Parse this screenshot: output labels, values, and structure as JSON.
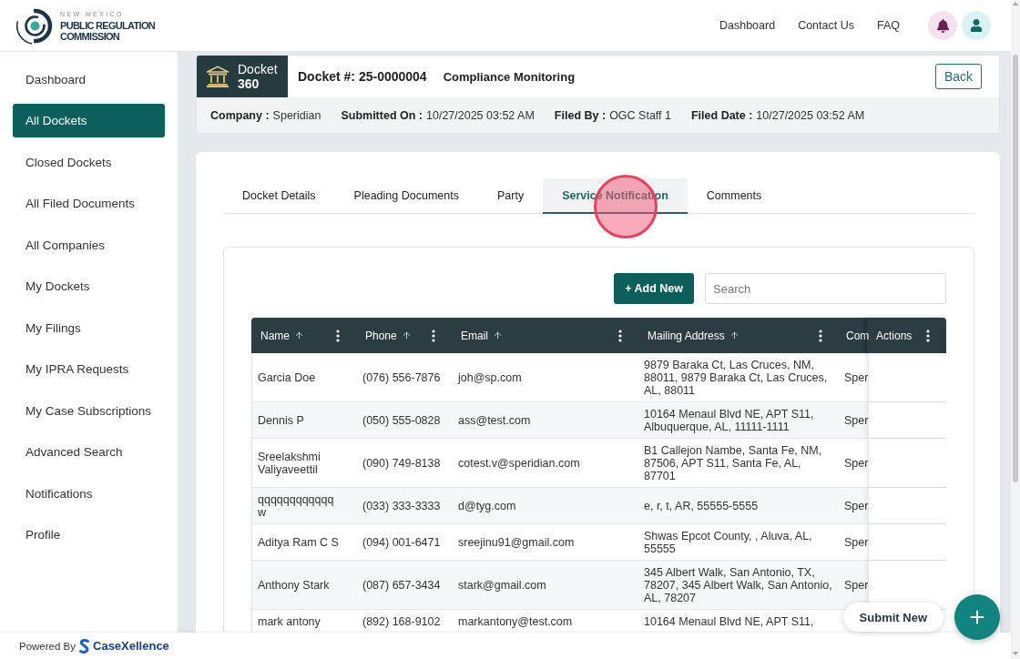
{
  "header": {
    "logo": {
      "subtitle": "NEW MEXICO",
      "title_lines": [
        "PUBLIC REGULATION",
        "COMMISSION"
      ]
    },
    "nav": [
      "Dashboard",
      "Contact Us",
      "FAQ"
    ]
  },
  "sidebar": {
    "items": [
      {
        "label": "Dashboard",
        "selected": false
      },
      {
        "label": "All Dockets",
        "selected": true
      },
      {
        "label": "Closed Dockets",
        "selected": false
      },
      {
        "label": "All Filed Documents",
        "selected": false
      },
      {
        "label": "All Companies",
        "selected": false
      },
      {
        "label": "My Dockets",
        "selected": false
      },
      {
        "label": "My Filings",
        "selected": false
      },
      {
        "label": "My IPRA Requests",
        "selected": false
      },
      {
        "label": "My Case Subscriptions",
        "selected": false
      },
      {
        "label": "Advanced Search",
        "selected": false
      },
      {
        "label": "Notifications",
        "selected": false
      },
      {
        "label": "Profile",
        "selected": false
      }
    ]
  },
  "docket": {
    "badge": {
      "title": "Docket",
      "number": "360"
    },
    "number": "Docket #: 25-0000004",
    "type": "Compliance Monitoring",
    "back_button": "Back",
    "meta": [
      {
        "label": "Company :",
        "value": "Speridian"
      },
      {
        "label": "Submitted On :",
        "value": "10/27/2025 03:52 AM"
      },
      {
        "label": "Filed By :",
        "value": "OGC Staff 1"
      },
      {
        "label": "Filed Date :",
        "value": "10/27/2025 03:52 AM"
      }
    ]
  },
  "tabs": [
    {
      "label": "Docket Details",
      "selected": false
    },
    {
      "label": "Pleading Documents",
      "selected": false
    },
    {
      "label": "Party",
      "selected": false
    },
    {
      "label": "Service Notification",
      "selected": true
    },
    {
      "label": "Comments",
      "selected": false
    }
  ],
  "service_list": {
    "add_button": "+ Add New",
    "search": {
      "placeholder": "Search"
    },
    "table": {
      "columns": [
        {
          "label": "Name",
          "sortable": true,
          "menu": true
        },
        {
          "label": "Phone",
          "sortable": true,
          "menu": true
        },
        {
          "label": "Email",
          "sortable": true,
          "menu": true
        },
        {
          "label": "Mailing Address",
          "sortable": true,
          "menu": true
        },
        {
          "label": "Com",
          "sortable": false,
          "menu": false
        },
        {
          "label": "Actions",
          "sortable": false,
          "menu": true
        }
      ],
      "rows": [
        {
          "name": "Garcia Doe",
          "phone": "(076) 556-7876",
          "email": "joh@sp.com",
          "mailing_address": "9879 Baraka Ct, Las Cruces, NM, 88011, 9879 Baraka Ct, Las Cruces, AL, 88011",
          "company": "Sper"
        },
        {
          "name": "Dennis P",
          "phone": "(050) 555-0828",
          "email": "ass@test.com",
          "mailing_address": "10164 Menaul Blvd NE, APT S11, Albuquerque, AL, 11111-1111",
          "company": "Sper"
        },
        {
          "name": "Sreelakshmi Valiyaveettil",
          "phone": "(090) 749-8138",
          "email": "cotest.v@speridian.com",
          "mailing_address": "B1 Callejon Nambe, Santa Fe, NM, 87506, APT S11, Santa Fe, AL, 87701",
          "company": "Sper"
        },
        {
          "name": "qqqqqqqqqqqqw",
          "phone": "(033) 333-3333",
          "email": "d@tyg.com",
          "mailing_address": "e, r, t, AR, 55555-5555",
          "company": "Sper"
        },
        {
          "name": "Aditya Ram C S",
          "phone": "(094) 001-6471",
          "email": "sreejinu91@gmail.com",
          "mailing_address": "Shwas Epcot County, , Aluva, AL, 55555",
          "company": "Sper"
        },
        {
          "name": "Anthony Stark",
          "phone": "(087) 657-3434",
          "email": "stark@gmail.com",
          "mailing_address": "345 Albert Walk, San Antonio, TX, 78207, 345 Albert Walk, San Antonio, AL, 78207",
          "company": "Sper"
        },
        {
          "name": "mark antony",
          "phone": "(892) 168-9102",
          "email": "markantony@test.com",
          "mailing_address": "10164 Menaul Blvd NE, APT S11,"
        }
      ]
    }
  },
  "submit_button": "Submit New",
  "footer": {
    "powered_by": "Powered By",
    "brand": "CaseXellence"
  }
}
